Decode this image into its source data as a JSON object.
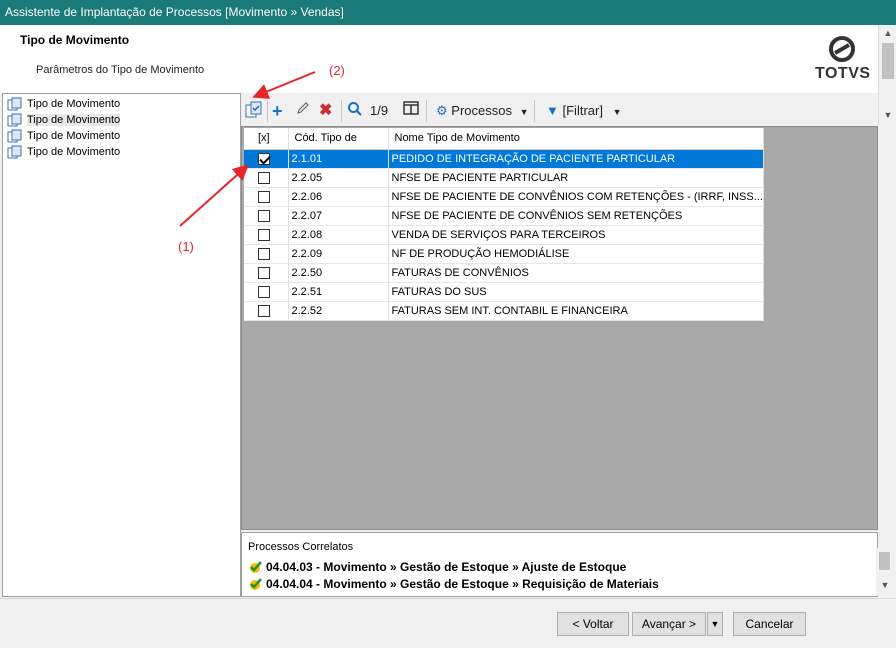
{
  "window": {
    "title": "Assistente de Implantação de Processos [Movimento » Vendas]"
  },
  "header": {
    "title": "Tipo de Movimento",
    "subtitle": "Parâmetros do Tipo de Movimento",
    "logo_text": "TOTVS"
  },
  "tree": {
    "items": [
      {
        "label": "Tipo de Movimento"
      },
      {
        "label": "Tipo de Movimento",
        "selected": true
      },
      {
        "label": "Tipo de Movimento"
      },
      {
        "label": "Tipo de Movimento"
      }
    ]
  },
  "toolbar": {
    "page_indicator": "1/9",
    "processos_label": "Processos",
    "filtrar_label": "[Filtrar]"
  },
  "grid": {
    "columns": [
      "[x]",
      "Cód. Tipo de",
      "Nome Tipo de Movimento"
    ],
    "rows": [
      {
        "checked": true,
        "code": "2.1.01",
        "name": "PEDIDO DE INTEGRAÇÃO  DE PACIENTE PARTICULAR",
        "selected": true
      },
      {
        "checked": false,
        "code": "2.2.05",
        "name": "NFSE  DE PACIENTE PARTICULAR"
      },
      {
        "checked": false,
        "code": "2.2.06",
        "name": "NFSE  DE PACIENTE DE CONVÊNIOS COM RETENÇÕES - (IRRF, INSS..."
      },
      {
        "checked": false,
        "code": "2.2.07",
        "name": "NFSE  DE PACIENTE DE CONVÊNIOS SEM RETENÇÕES"
      },
      {
        "checked": false,
        "code": "2.2.08",
        "name": "VENDA DE SERVIÇOS PARA TERCEIROS"
      },
      {
        "checked": false,
        "code": "2.2.09",
        "name": "NF DE PRODUÇÃO HEMODIÁLISE"
      },
      {
        "checked": false,
        "code": "2.2.50",
        "name": "FATURAS DE CONVÊNIOS"
      },
      {
        "checked": false,
        "code": "2.2.51",
        "name": "FATURAS DO SUS"
      },
      {
        "checked": false,
        "code": "2.2.52",
        "name": "FATURAS SEM INT. CONTABIL E FINANCEIRA"
      }
    ]
  },
  "related": {
    "title": "Processos Correlatos",
    "items": [
      "04.04.03 - Movimento » Gestão de Estoque » Ajuste de Estoque",
      "04.04.04 - Movimento » Gestão de Estoque » Requisição de Materiais"
    ]
  },
  "annotations": {
    "label1": "(1)",
    "label2": "(2)"
  },
  "footer": {
    "back": "< Voltar",
    "next": "Avançar >",
    "cancel": "Cancelar"
  },
  "colors": {
    "titlebar": "#1a7a7a",
    "selection": "#0078d7",
    "annotation": "#e8242c"
  }
}
